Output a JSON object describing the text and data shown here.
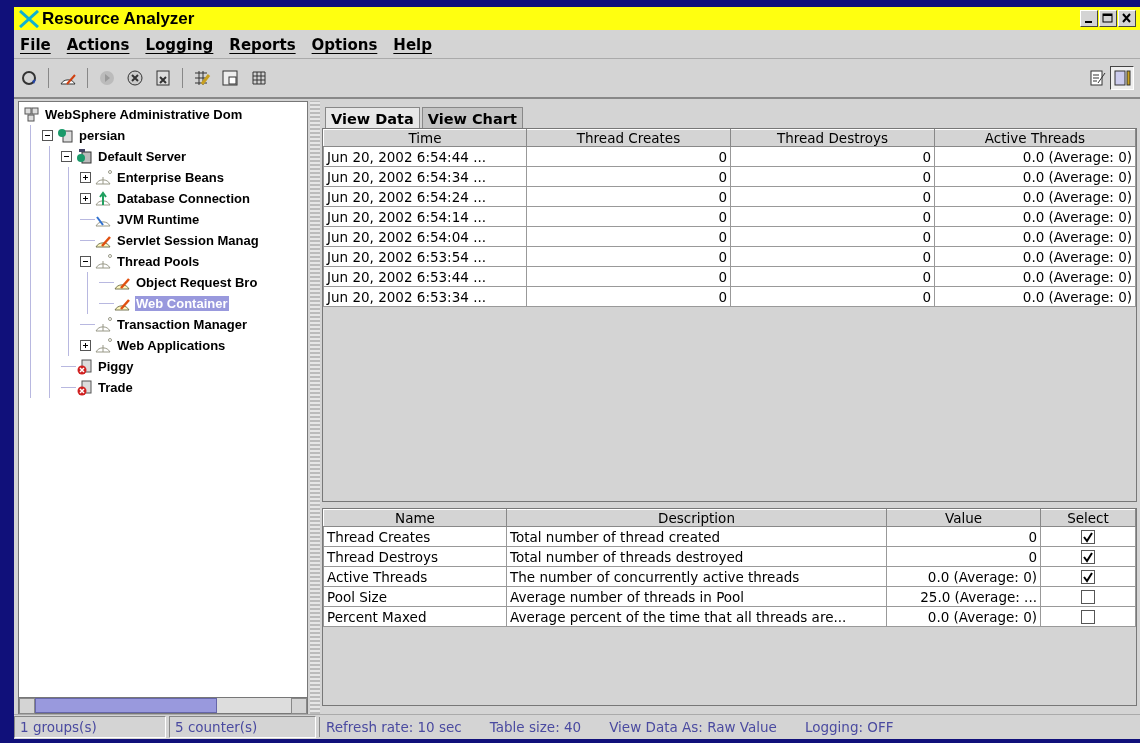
{
  "window": {
    "title": "Resource Analyzer"
  },
  "menu": [
    "File",
    "Actions",
    "Logging",
    "Reports",
    "Options",
    "Help"
  ],
  "toolbar": [
    {
      "kind": "refresh",
      "disabled": false
    },
    {
      "kind": "sep"
    },
    {
      "kind": "gauge",
      "disabled": false
    },
    {
      "kind": "sep"
    },
    {
      "kind": "start",
      "disabled": true
    },
    {
      "kind": "stop",
      "disabled": false
    },
    {
      "kind": "clear",
      "disabled": false
    },
    {
      "kind": "sep"
    },
    {
      "kind": "edit-grid",
      "disabled": false
    },
    {
      "kind": "counter",
      "disabled": false
    },
    {
      "kind": "grid",
      "disabled": false
    }
  ],
  "view_toggles": [
    {
      "kind": "notes",
      "selected": false
    },
    {
      "kind": "panel",
      "selected": true
    }
  ],
  "tree": [
    {
      "label": "WebSphere Administrative Dom",
      "kind": "domain",
      "selected": false,
      "children": [
        {
          "label": "persian",
          "kind": "node",
          "selected": false,
          "expanded": true,
          "children": [
            {
              "label": "Default Server",
              "kind": "server",
              "selected": false,
              "expanded": true,
              "children": [
                {
                  "label": "Enterprise Beans",
                  "kind": "meter",
                  "selected": false,
                  "expanded": false
                },
                {
                  "label": "Database Connection",
                  "kind": "meter-up",
                  "selected": false,
                  "expanded": false
                },
                {
                  "label": "JVM Runtime",
                  "kind": "meter-blue",
                  "selected": false
                },
                {
                  "label": "Servlet Session Manag",
                  "kind": "meter-active",
                  "selected": false
                },
                {
                  "label": "Thread Pools",
                  "kind": "meter",
                  "selected": false,
                  "expanded": true,
                  "children": [
                    {
                      "label": "Object Request Bro",
                      "kind": "meter-active",
                      "selected": false
                    },
                    {
                      "label": "Web Container",
                      "kind": "meter-active",
                      "selected": true
                    }
                  ]
                },
                {
                  "label": "Transaction Manager",
                  "kind": "meter",
                  "selected": false
                },
                {
                  "label": "Web Applications",
                  "kind": "meter",
                  "selected": false,
                  "expanded": false
                }
              ]
            },
            {
              "label": "Piggy",
              "kind": "server-stopped",
              "selected": false
            },
            {
              "label": "Trade",
              "kind": "server-stopped",
              "selected": false
            }
          ]
        }
      ]
    }
  ],
  "tabs": [
    {
      "label": "View Data",
      "selected": true
    },
    {
      "label": "View Chart",
      "selected": false
    }
  ],
  "data_table": {
    "columns": [
      "Time",
      "Thread Creates",
      "Thread Destroys",
      "Active Threads"
    ],
    "rows": [
      [
        "Jun 20, 2002 6:54:44 ...",
        "0",
        "0",
        "0.0 (Average: 0)"
      ],
      [
        "Jun 20, 2002 6:54:34 ...",
        "0",
        "0",
        "0.0 (Average: 0)"
      ],
      [
        "Jun 20, 2002 6:54:24 ...",
        "0",
        "0",
        "0.0 (Average: 0)"
      ],
      [
        "Jun 20, 2002 6:54:14 ...",
        "0",
        "0",
        "0.0 (Average: 0)"
      ],
      [
        "Jun 20, 2002 6:54:04 ...",
        "0",
        "0",
        "0.0 (Average: 0)"
      ],
      [
        "Jun 20, 2002 6:53:54 ...",
        "0",
        "0",
        "0.0 (Average: 0)"
      ],
      [
        "Jun 20, 2002 6:53:44 ...",
        "0",
        "0",
        "0.0 (Average: 0)"
      ],
      [
        "Jun 20, 2002 6:53:34 ...",
        "0",
        "0",
        "0.0 (Average: 0)"
      ]
    ]
  },
  "counter_table": {
    "columns": [
      "Name",
      "Description",
      "Value",
      "Select"
    ],
    "rows": [
      {
        "name": "Thread Creates",
        "description": "Total number of thread created",
        "value": "0",
        "checked": true
      },
      {
        "name": "Thread Destroys",
        "description": "Total number of threads destroyed",
        "value": "0",
        "checked": true
      },
      {
        "name": "Active Threads",
        "description": "The number of concurrently active threads",
        "value": "0.0 (Average: 0)",
        "checked": true
      },
      {
        "name": "Pool Size",
        "description": "Average number of threads in Pool",
        "value": "25.0 (Average: ...",
        "checked": false
      },
      {
        "name": "Percent Maxed",
        "description": "Average percent of the time that all threads are...",
        "value": "0.0 (Average: 0)",
        "checked": false
      }
    ]
  },
  "status_bar": [
    "1 groups(s)",
    "5 counter(s)",
    "Refresh rate: 10 sec",
    "Table size: 40",
    "View Data As: Raw Value",
    "Logging: OFF"
  ]
}
